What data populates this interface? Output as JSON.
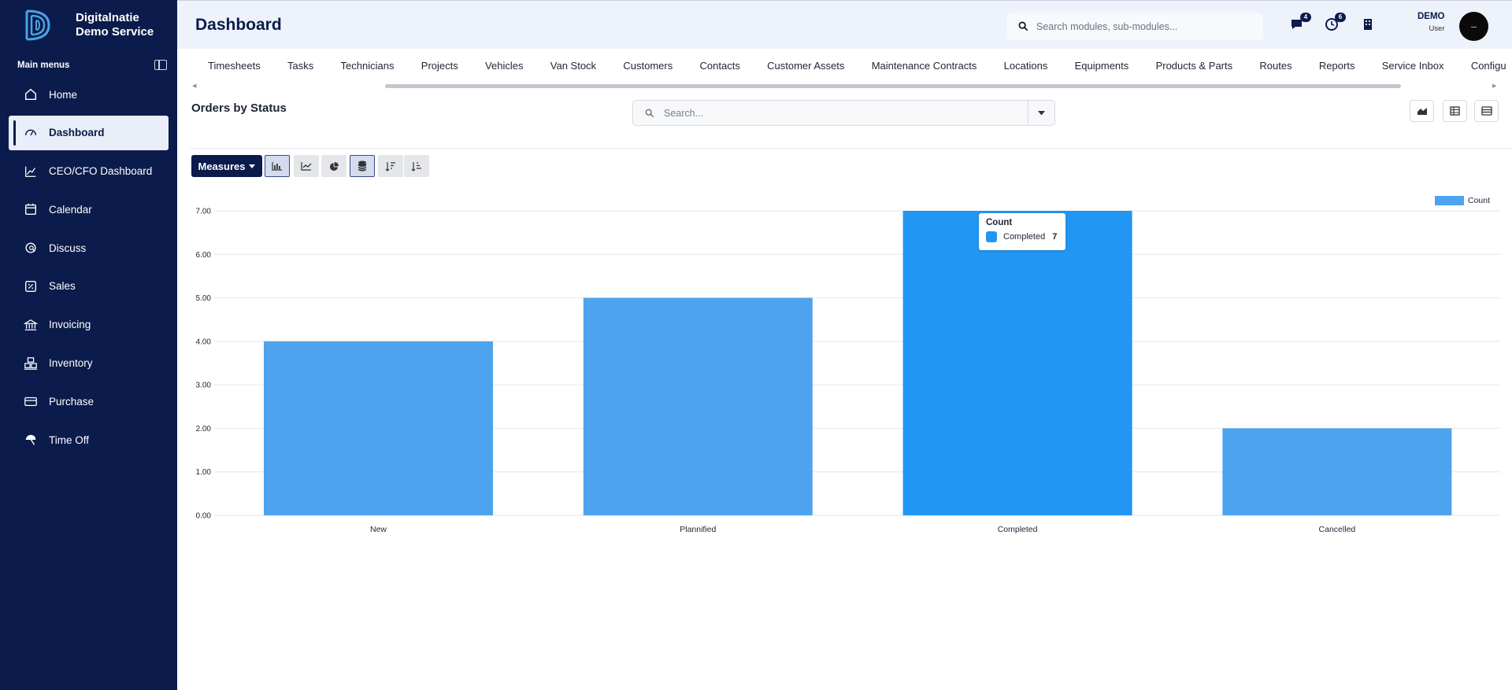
{
  "brand": {
    "line1": "Digitalnatie",
    "line2": "Demo Service"
  },
  "sidebar": {
    "section_title": "Main menus",
    "items": [
      {
        "label": "Home",
        "icon": "home-icon"
      },
      {
        "label": "Dashboard",
        "icon": "gauge-icon",
        "active": true
      },
      {
        "label": "CEO/CFO Dashboard",
        "icon": "trend-line-icon"
      },
      {
        "label": "Calendar",
        "icon": "calendar-icon"
      },
      {
        "label": "Discuss",
        "icon": "discuss-icon"
      },
      {
        "label": "Sales",
        "icon": "sales-icon"
      },
      {
        "label": "Invoicing",
        "icon": "bank-icon"
      },
      {
        "label": "Inventory",
        "icon": "inventory-icon"
      },
      {
        "label": "Purchase",
        "icon": "card-icon"
      },
      {
        "label": "Time Off",
        "icon": "umbrella-icon"
      }
    ]
  },
  "header": {
    "title": "Dashboard",
    "search_placeholder": "Search modules, sub-modules...",
    "messages_badge": "4",
    "activities_badge": "6",
    "user_name": "DEMO",
    "user_role": "User"
  },
  "tabs": [
    "Timesheets",
    "Tasks",
    "Technicians",
    "Projects",
    "Vehicles",
    "Van Stock",
    "Customers",
    "Contacts",
    "Customer Assets",
    "Maintenance Contracts",
    "Locations",
    "Equipments",
    "Products & Parts",
    "Routes",
    "Reports",
    "Service Inbox",
    "Configu"
  ],
  "view": {
    "title": "Orders by Status",
    "search_placeholder": "Search...",
    "measures_label": "Measures"
  },
  "tooltip": {
    "title": "Count",
    "label": "Completed",
    "value": "7"
  },
  "colors": {
    "bar": "#4da3ee",
    "bar_highlight": "#2196f3",
    "sidebar": "#0b1b4b"
  },
  "chart_data": {
    "type": "bar",
    "categories": [
      "New",
      "Plannified",
      "Completed",
      "Cancelled"
    ],
    "series": [
      {
        "name": "Count",
        "values": [
          4,
          5,
          7,
          2
        ]
      }
    ],
    "yticks": [
      "0.00",
      "1.00",
      "2.00",
      "3.00",
      "4.00",
      "5.00",
      "6.00",
      "7.00"
    ],
    "ylim": [
      0,
      7
    ],
    "legend": "top-right",
    "grid": true,
    "highlighted_category": "Completed"
  }
}
